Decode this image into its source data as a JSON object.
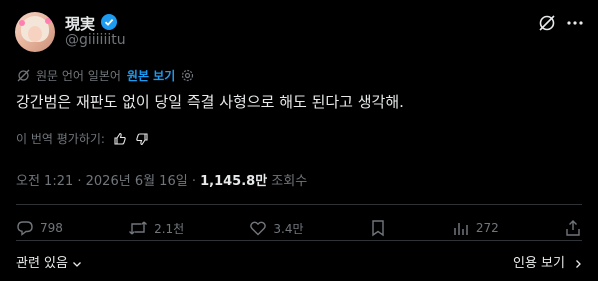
{
  "header": {
    "display_name": "現実",
    "handle": "@giiiiiitu"
  },
  "translation": {
    "language_note": "원문 언어 일본어",
    "show_original_label": "원본 보기"
  },
  "tweet": {
    "text": "강간범은 재판도 없이 당일 즉결 사형으로 해도 된다고 생각해."
  },
  "rate": {
    "label": "이 번역 평가하기:"
  },
  "meta": {
    "timestamp": "오전 1:21 · 2026년 6월 16일 · ",
    "views_count": "1,145.8만",
    "views_label": " 조회수"
  },
  "actions": {
    "replies": "798",
    "retweets": "2.1천",
    "likes": "3.4만",
    "bookmarks": "272"
  },
  "footer": {
    "related_label": "관련 있음",
    "quotes_label": "인용 보기"
  },
  "colors": {
    "accent": "#1d9bf0",
    "text": "#e7e9ea",
    "muted": "#71767b",
    "divider": "#2f3336"
  }
}
